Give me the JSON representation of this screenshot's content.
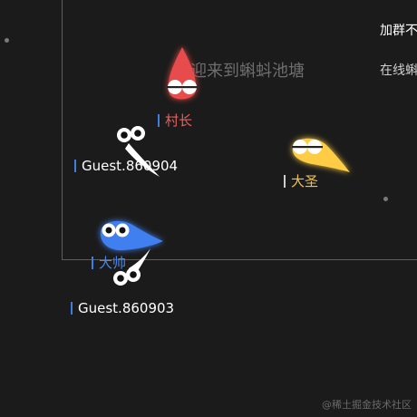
{
  "game": {
    "welcome_text": "欢迎来到蝌蚪池塘",
    "side_panel": {
      "join_group_text": "加群不",
      "online_text": "在线蝌"
    },
    "watermark": "@稀土掘金技术社区",
    "players": [
      {
        "id": "cunzhang",
        "name": "村长",
        "color": "#e84b4b",
        "name_color": "#e8605b",
        "bar_color": "#3d7fe0"
      },
      {
        "id": "dasheng",
        "name": "大圣",
        "color": "#ffcc44",
        "name_color": "#f3c44a",
        "bar_color": "#cfcfcf"
      },
      {
        "id": "dashuai",
        "name": "大帅",
        "color": "#3f7ff0",
        "name_color": "#4a86f0",
        "bar_color": "#3d7fe0"
      },
      {
        "id": "guest-860904",
        "name": "Guest.860904",
        "color": "#ffffff",
        "name_color": "#ffffff",
        "bar_color": "#3d7fe0"
      },
      {
        "id": "guest-860903",
        "name": "Guest.860903",
        "color": "#ffffff",
        "name_color": "#ffffff",
        "bar_color": "#3d7fe0"
      }
    ]
  }
}
